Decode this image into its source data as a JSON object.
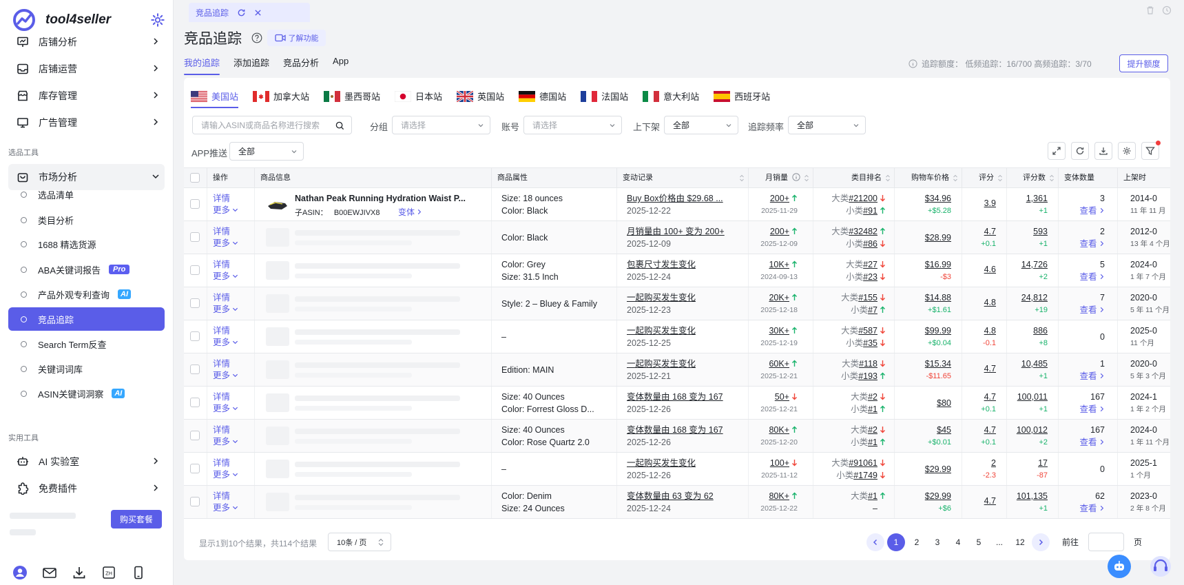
{
  "sidebar": {
    "brand": "tool4seller",
    "nav_top": [
      {
        "label": "店铺分析",
        "icon": "chart-presentation-icon"
      },
      {
        "label": "店铺运营",
        "icon": "inbox-icon"
      },
      {
        "label": "库存管理",
        "icon": "store-icon"
      },
      {
        "label": "广告管理",
        "icon": "monitor-icon"
      }
    ],
    "group_selection": "选品工具",
    "market_analysis": "市场分析",
    "sub_items": [
      {
        "label": "选品清单"
      },
      {
        "label": "类目分析"
      },
      {
        "label": "1688 精选货源"
      },
      {
        "label": "ABA关键词报告",
        "badge": "Pro"
      },
      {
        "label": "产品外观专利查询",
        "badge": "AI"
      },
      {
        "label": "竞品追踪"
      },
      {
        "label": "Search Term反查"
      },
      {
        "label": "关键词词库"
      },
      {
        "label": "ASIN关键词洞察",
        "badge": "AI"
      }
    ],
    "group_tools": "实用工具",
    "nav_tools": [
      {
        "label": "AI 实验室"
      },
      {
        "label": "免费插件"
      }
    ],
    "buy_button": "购买套餐"
  },
  "top_tab": {
    "label": "竞品追踪"
  },
  "header": {
    "title": "竞品追踪",
    "feature_button": "了解功能",
    "tabs": [
      "我的追踪",
      "添加追踪",
      "竞品分析",
      "App"
    ],
    "quota": "追踪额度：  低频追踪：16/700 高频追踪：3/70",
    "upgrade_button": "提升额度"
  },
  "sites": [
    "美国站",
    "加拿大站",
    "墨西哥站",
    "日本站",
    "英国站",
    "德国站",
    "法国站",
    "意大利站",
    "西班牙站"
  ],
  "filters": {
    "search_placeholder": "请输入ASIN或商品名称进行搜索",
    "group_label": "分组",
    "group_placeholder": "请选择",
    "account_label": "账号",
    "account_placeholder": "请选择",
    "shelf_label": "上下架",
    "shelf_value": "全部",
    "freq_label": "追踪频率",
    "freq_value": "全部",
    "app_label": "APP推送",
    "app_value": "全部"
  },
  "table": {
    "columns": [
      "操作",
      "商品信息",
      "商品属性",
      "变动记录",
      "月销量",
      "类目排名",
      "购物车价格",
      "评分",
      "评分数",
      "变体数量",
      "上架时"
    ],
    "op_detail": "详情",
    "op_more": "更多",
    "look": "查看",
    "big_cat": "大类",
    "small_cat": "小类",
    "rows": [
      {
        "title": "Nathan Peak Running Hydration Waist P...",
        "asin_label": "子ASIN：",
        "asin": "B00EWJIVX8",
        "variant_link": "变体",
        "attrs": [
          "Size: 18 ounces",
          "Color: Black"
        ],
        "change": "Buy Box价格由 $29.68 ...",
        "change_date": "2025-12-22",
        "sales": "200+",
        "sales_dir": "up",
        "sales_date": "2025-11-29",
        "big_rank": "#21200",
        "big_dir": "down",
        "small_rank": "#91",
        "small_dir": "up",
        "price": "$34.96",
        "price_delta": "+$5.28",
        "price_dir": "up",
        "rating": "3.9",
        "rating_delta": "",
        "rating_dir": "",
        "reviews": "1,361",
        "reviews_delta": "+1",
        "reviews_dir": "up",
        "variants": "3",
        "variants_look": true,
        "launch": "2014-0",
        "launch_age": "11 年 11 月"
      },
      {
        "title": "",
        "attrs": [
          "Color: Black"
        ],
        "change": "月销量由 100+ 变为 200+",
        "change_date": "2025-12-09",
        "sales": "200+",
        "sales_dir": "up",
        "sales_date": "2025-12-09",
        "big_rank": "#32482",
        "big_dir": "up",
        "small_rank": "#86",
        "small_dir": "down",
        "price": "$28.99",
        "price_delta": "",
        "price_dir": "",
        "rating": "4.7",
        "rating_delta": "+0.1",
        "rating_dir": "up",
        "reviews": "593",
        "reviews_delta": "+1",
        "reviews_dir": "up",
        "variants": "2",
        "variants_look": true,
        "launch": "2012-0",
        "launch_age": "13 年 4 个月"
      },
      {
        "title": "",
        "attrs": [
          "Color: Grey",
          "Size: 31.5 Inch"
        ],
        "change": "包裹尺寸发生变化",
        "change_date": "2025-12-24",
        "sales": "10K+",
        "sales_dir": "up",
        "sales_date": "2024-09-13",
        "big_rank": "#27",
        "big_dir": "down",
        "small_rank": "#23",
        "small_dir": "down",
        "price": "$16.99",
        "price_delta": "-$3",
        "price_dir": "down",
        "rating": "4.6",
        "rating_delta": "",
        "rating_dir": "",
        "reviews": "14,726",
        "reviews_delta": "+2",
        "reviews_dir": "up",
        "variants": "5",
        "variants_look": true,
        "launch": "2024-0",
        "launch_age": "1 年 7 个月"
      },
      {
        "title": "",
        "attrs": [
          "Style: 2 – Bluey & Family"
        ],
        "change": "一起购买发生变化",
        "change_date": "2025-12-23",
        "sales": "20K+",
        "sales_dir": "up",
        "sales_date": "2025-12-18",
        "big_rank": "#155",
        "big_dir": "down",
        "small_rank": "#7",
        "small_dir": "up",
        "price": "$14.88",
        "price_delta": "+$1.61",
        "price_dir": "up",
        "rating": "4.8",
        "rating_delta": "",
        "rating_dir": "",
        "reviews": "24,812",
        "reviews_delta": "+19",
        "reviews_dir": "up",
        "variants": "7",
        "variants_look": true,
        "launch": "2020-0",
        "launch_age": "5 年 11 个月"
      },
      {
        "title": "",
        "attrs": [
          "–"
        ],
        "change": "一起购买发生变化",
        "change_date": "2025-12-25",
        "sales": "30K+",
        "sales_dir": "up",
        "sales_date": "2025-12-19",
        "big_rank": "#587",
        "big_dir": "down",
        "small_rank": "#35",
        "small_dir": "down",
        "price": "$99.99",
        "price_delta": "+$0.04",
        "price_dir": "up",
        "rating": "4.8",
        "rating_delta": "-0.1",
        "rating_dir": "down",
        "reviews": "886",
        "reviews_delta": "+8",
        "reviews_dir": "up",
        "variants": "0",
        "variants_look": false,
        "launch": "2025-0",
        "launch_age": "11 个月"
      },
      {
        "title": "",
        "attrs": [
          "Edition: MAIN"
        ],
        "change": "一起购买发生变化",
        "change_date": "2025-12-21",
        "sales": "60K+",
        "sales_dir": "up",
        "sales_date": "2025-12-21",
        "big_rank": "#118",
        "big_dir": "down",
        "small_rank": "#193",
        "small_dir": "up",
        "price": "$15.34",
        "price_delta": "-$11.65",
        "price_dir": "down",
        "rating": "4.7",
        "rating_delta": "",
        "rating_dir": "",
        "reviews": "10,485",
        "reviews_delta": "+1",
        "reviews_dir": "up",
        "variants": "1",
        "variants_look": true,
        "launch": "2020-0",
        "launch_age": "5 年 3 个月"
      },
      {
        "title": "",
        "attrs": [
          "Size: 40 Ounces",
          "Color: Forrest Gloss D..."
        ],
        "change": "变体数量由 168 变为 167",
        "change_date": "2025-12-26",
        "sales": "50+",
        "sales_dir": "down",
        "sales_date": "2025-12-21",
        "big_rank": "#2",
        "big_dir": "down",
        "small_rank": "#1",
        "small_dir": "up",
        "price": "$80",
        "price_delta": "",
        "price_dir": "",
        "rating": "4.7",
        "rating_delta": "+0.1",
        "rating_dir": "up",
        "reviews": "100,011",
        "reviews_delta": "+1",
        "reviews_dir": "up",
        "variants": "167",
        "variants_look": true,
        "launch": "2024-1",
        "launch_age": "1 年 2 个月"
      },
      {
        "title": "",
        "attrs": [
          "Size: 40 Ounces",
          "Color: Rose Quartz 2.0"
        ],
        "change": "变体数量由 168 变为 167",
        "change_date": "2025-12-26",
        "sales": "80K+",
        "sales_dir": "up",
        "sales_date": "2025-12-20",
        "big_rank": "#2",
        "big_dir": "down",
        "small_rank": "#1",
        "small_dir": "up",
        "price": "$45",
        "price_delta": "+$0.01",
        "price_dir": "up",
        "rating": "4.7",
        "rating_delta": "+0.1",
        "rating_dir": "up",
        "reviews": "100,012",
        "reviews_delta": "+2",
        "reviews_dir": "up",
        "variants": "167",
        "variants_look": true,
        "launch": "2024-0",
        "launch_age": "1 年 11 个月"
      },
      {
        "title": "",
        "attrs": [
          "–"
        ],
        "change": "一起购买发生变化",
        "change_date": "2025-12-26",
        "sales": "100+",
        "sales_dir": "down",
        "sales_date": "2025-11-12",
        "big_rank": "#91061",
        "big_dir": "down",
        "small_rank": "#1749",
        "small_dir": "down",
        "price": "$29.99",
        "price_delta": "",
        "price_dir": "",
        "rating": "2",
        "rating_delta": "-2.3",
        "rating_dir": "down",
        "reviews": "17",
        "reviews_delta": "-87",
        "reviews_dir": "down",
        "variants": "0",
        "variants_look": false,
        "launch": "2025-1",
        "launch_age": "1 个月"
      },
      {
        "title": "",
        "attrs": [
          "Color: Denim",
          "Size: 24 Ounces"
        ],
        "change": "变体数量由 63 变为 62",
        "change_date": "2025-12-24",
        "sales": "80K+",
        "sales_dir": "up",
        "sales_date": "2025-12-22",
        "big_rank": "#1",
        "big_dir": "up",
        "small_rank": "",
        "small_dir": "",
        "small_dash": "–",
        "price": "$29.99",
        "price_delta": "+$6",
        "price_dir": "up",
        "rating": "4.7",
        "rating_delta": "",
        "rating_dir": "",
        "reviews": "101,135",
        "reviews_delta": "+1",
        "reviews_dir": "up",
        "variants": "62",
        "variants_look": true,
        "launch": "2023-0",
        "launch_age": "2 年 8 个月"
      }
    ]
  },
  "pagination": {
    "info": "显示1到10个结果，共114个结果",
    "page_size": "10条 / 页",
    "pages": [
      "1",
      "2",
      "3",
      "4",
      "5",
      "...",
      "12"
    ],
    "current": "1",
    "goto_label": "前往",
    "goto_tail": "页"
  },
  "colors": {
    "accent": "#5a5de8",
    "up": "#17b26a",
    "down": "#f04438"
  }
}
